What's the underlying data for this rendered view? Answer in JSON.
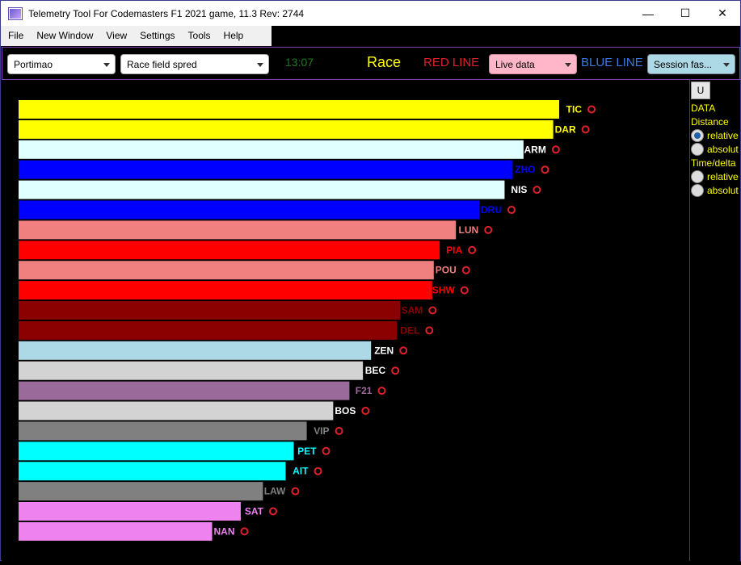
{
  "window": {
    "title": "Telemetry Tool For Codemasters F1 2021 game, 11.3 Rev: 2744",
    "minimize": "—",
    "maximize": "☐",
    "close": "✕"
  },
  "menu": [
    "File",
    "New Window",
    "View",
    "Settings",
    "Tools",
    "Help"
  ],
  "toolbar": {
    "track": "Portimao",
    "view": "Race field spred",
    "time": "13:07",
    "session": "Race",
    "red_line_label": "RED LINE",
    "red_line_value": "Live data",
    "blue_line_label": "BLUE LINE",
    "blue_line_value": "Session fas...",
    "colors": {
      "time": "#1a7a1a",
      "session": "#ffff00",
      "red": "#e0202a",
      "blue": "#3a7ae0",
      "red_combo_bg": "#ffb6c8",
      "blue_combo_bg": "#add8e6"
    }
  },
  "side": {
    "button": "U",
    "data_label": "DATA",
    "distance_label": "Distance",
    "distance_options": [
      {
        "label": "relative",
        "selected": true
      },
      {
        "label": "absolut",
        "selected": false
      }
    ],
    "time_label": "Time/delta",
    "time_options": [
      {
        "label": "relative",
        "selected": false
      },
      {
        "label": "absolut",
        "selected": false
      }
    ]
  },
  "chart_data": {
    "type": "bar",
    "orientation": "horizontal",
    "marker_color": "#e0202a",
    "drivers": [
      {
        "code": "TIC",
        "value": 100,
        "bar": "#ffff00",
        "text": "#ffff00"
      },
      {
        "code": "DAR",
        "value": 98.9,
        "bar": "#ffff00",
        "text": "#ffff00"
      },
      {
        "code": "ARM",
        "value": 93.4,
        "bar": "#e0ffff",
        "text": "#ffffff"
      },
      {
        "code": "ZHO",
        "value": 91.4,
        "bar": "#0000ff",
        "text": "#0000ff"
      },
      {
        "code": "NIS",
        "value": 89.9,
        "bar": "#e0ffff",
        "text": "#ffffff"
      },
      {
        "code": "DRU",
        "value": 85.2,
        "bar": "#0000ff",
        "text": "#0000ff"
      },
      {
        "code": "LUN",
        "value": 80.9,
        "bar": "#f08080",
        "text": "#f08080"
      },
      {
        "code": "PIA",
        "value": 77.9,
        "bar": "#ff0000",
        "text": "#ff0000"
      },
      {
        "code": "POU",
        "value": 76.8,
        "bar": "#f08080",
        "text": "#f08080"
      },
      {
        "code": "SHW",
        "value": 76.5,
        "bar": "#ff0000",
        "text": "#ff0000"
      },
      {
        "code": "SAM",
        "value": 70.6,
        "bar": "#8b0000",
        "text": "#8b0000"
      },
      {
        "code": "DEL",
        "value": 70.0,
        "bar": "#8b0000",
        "text": "#8b0000"
      },
      {
        "code": "ZEN",
        "value": 65.2,
        "bar": "#add8e6",
        "text": "#ffffff"
      },
      {
        "code": "BEC",
        "value": 63.7,
        "bar": "#d3d3d3",
        "text": "#ffffff"
      },
      {
        "code": "F21",
        "value": 61.2,
        "bar": "#9a6a9a",
        "text": "#9a6a9a"
      },
      {
        "code": "BOS",
        "value": 58.2,
        "bar": "#d3d3d3",
        "text": "#ffffff"
      },
      {
        "code": "VIP",
        "value": 53.3,
        "bar": "#808080",
        "text": "#808080"
      },
      {
        "code": "PET",
        "value": 50.9,
        "bar": "#00ffff",
        "text": "#00ffff"
      },
      {
        "code": "AIT",
        "value": 49.4,
        "bar": "#00ffff",
        "text": "#00ffff"
      },
      {
        "code": "LAW",
        "value": 45.2,
        "bar": "#808080",
        "text": "#808080"
      },
      {
        "code": "SAT",
        "value": 41.1,
        "bar": "#ee82ee",
        "text": "#ee82ee"
      },
      {
        "code": "NAN",
        "value": 35.8,
        "bar": "#ee82ee",
        "text": "#ee82ee"
      }
    ]
  }
}
